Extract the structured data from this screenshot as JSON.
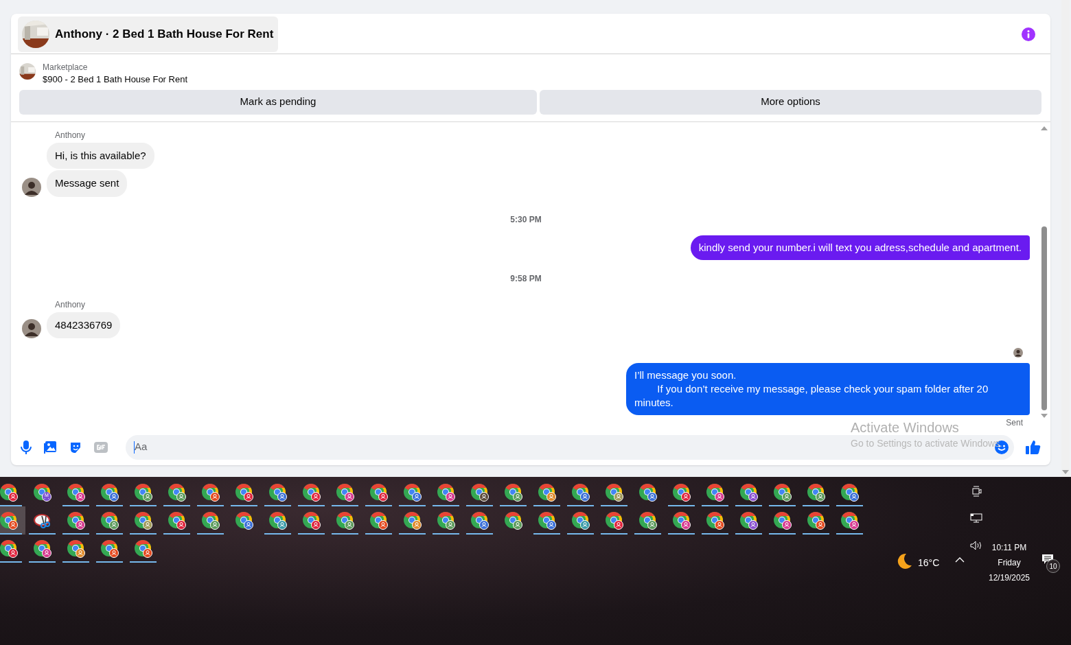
{
  "header": {
    "title": "Anthony · 2 Bed 1 Bath House For Rent"
  },
  "listing": {
    "source": "Marketplace",
    "title": "$900 - 2 Bed 1 Bath House For Rent"
  },
  "actions": [
    "Mark as pending",
    "More options"
  ],
  "messages": [
    {
      "kind": "incoming",
      "sender": "Anthony",
      "bubbles": [
        "Hi, is this available?",
        "Message sent"
      ]
    },
    {
      "kind": "time",
      "text": "5:30 PM"
    },
    {
      "kind": "outgoing",
      "text": "kindly send your number.i will text you adress,schedule and apartment.",
      "color": "#6a1bf0",
      "seen": false
    },
    {
      "kind": "time",
      "text": "9:58 PM"
    },
    {
      "kind": "incoming",
      "sender": "Anthony",
      "bubbles": [
        "4842336769"
      ]
    },
    {
      "kind": "outgoing",
      "text": "I’ll message you soon.\n        If you don’t receive my message, please check your spam folder after 20 minutes.",
      "color": "#0a5cf2",
      "seen": true,
      "status": "Sent"
    }
  ],
  "composer": {
    "placeholder": "Aa"
  },
  "os_notice": {
    "title": "Activate Windows",
    "text": "Go to Settings to activate Windows."
  },
  "taskbar": {
    "apps": [
      {
        "kind": "chrome",
        "color": "#e0233c",
        "running": true,
        "selected": false
      },
      {
        "kind": "chrome",
        "color": "#7b4fd0",
        "letter": "M",
        "running": false,
        "selected": false
      },
      {
        "kind": "chrome",
        "color": "#d8398f",
        "running": true,
        "selected": false
      },
      {
        "kind": "chrome",
        "color": "#3a6fd8",
        "running": true,
        "selected": false
      },
      {
        "kind": "chrome",
        "color": "#5b9a5b",
        "running": true,
        "selected": false
      },
      {
        "kind": "chrome",
        "color": "#5b9a5b",
        "running": true,
        "selected": false
      },
      {
        "kind": "chrome",
        "color": "#e4481d",
        "running": true,
        "selected": false
      },
      {
        "kind": "chrome",
        "color": "#e0233c",
        "running": true,
        "selected": false
      },
      {
        "kind": "chrome",
        "color": "#3a6fd8",
        "running": true,
        "selected": false
      },
      {
        "kind": "chrome",
        "color": "#e0233c",
        "running": true,
        "selected": false
      },
      {
        "kind": "chrome",
        "color": "#d8398f",
        "running": true,
        "selected": false
      },
      {
        "kind": "chrome",
        "color": "#e0233c",
        "running": true,
        "selected": false
      },
      {
        "kind": "chrome",
        "color": "#3a6fd8",
        "running": true,
        "selected": false
      },
      {
        "kind": "chrome",
        "color": "#d8398f",
        "running": true,
        "selected": false
      },
      {
        "kind": "chrome",
        "color": "#5a4a3a",
        "running": true,
        "selected": false
      },
      {
        "kind": "chrome",
        "color": "#5b9a5b",
        "running": true,
        "selected": false
      },
      {
        "kind": "chrome",
        "color": "#e08a2a",
        "running": true,
        "selected": false
      },
      {
        "kind": "chrome",
        "color": "#3a6fd8",
        "running": true,
        "selected": false
      },
      {
        "kind": "chrome",
        "color": "#a09a5a",
        "running": true,
        "selected": false
      },
      {
        "kind": "chrome",
        "color": "#3a6fd8",
        "running": false,
        "selected": false
      },
      {
        "kind": "chrome",
        "color": "#e0233c",
        "running": true,
        "selected": false
      },
      {
        "kind": "chrome",
        "color": "#d8398f",
        "running": true,
        "selected": false
      },
      {
        "kind": "chrome",
        "color": "#8a4fd0",
        "running": true,
        "selected": false
      },
      {
        "kind": "chrome",
        "color": "#5b9a5b",
        "running": true,
        "selected": false
      },
      {
        "kind": "chrome",
        "color": "#5b9a5b",
        "running": true,
        "selected": false
      },
      {
        "kind": "chrome",
        "color": "#3a6fd8",
        "running": true,
        "selected": false
      },
      {
        "kind": "chrome",
        "color": "#e4481d",
        "running": true,
        "selected": true
      },
      {
        "kind": "snip",
        "running": true,
        "selected": false
      },
      {
        "kind": "chrome",
        "color": "#d8398f",
        "running": true,
        "selected": false
      },
      {
        "kind": "chrome",
        "color": "#5b9a5b",
        "running": true,
        "selected": false
      },
      {
        "kind": "chrome",
        "color": "#a09a5a",
        "running": true,
        "selected": false
      },
      {
        "kind": "chrome",
        "color": "#e0233c",
        "running": true,
        "selected": false
      },
      {
        "kind": "chrome",
        "color": "#5b9a5b",
        "running": true,
        "selected": false
      },
      {
        "kind": "chrome",
        "color": "#3a6fd8",
        "running": false,
        "selected": false
      },
      {
        "kind": "chrome",
        "color": "#3a9aa8",
        "running": true,
        "selected": false
      },
      {
        "kind": "chrome",
        "color": "#e0233c",
        "running": true,
        "selected": false
      },
      {
        "kind": "chrome",
        "color": "#5b9a5b",
        "running": true,
        "selected": false
      },
      {
        "kind": "chrome",
        "color": "#e4481d",
        "running": true,
        "selected": false
      },
      {
        "kind": "chrome",
        "color": "#e08a2a",
        "running": true,
        "selected": false
      },
      {
        "kind": "chrome",
        "color": "#5b9a5b",
        "running": true,
        "selected": false
      },
      {
        "kind": "chrome",
        "color": "#3a6fd8",
        "running": true,
        "selected": false
      },
      {
        "kind": "chrome",
        "color": "#5b9a5b",
        "running": false,
        "selected": false
      },
      {
        "kind": "chrome",
        "color": "#3a6fd8",
        "running": true,
        "selected": false
      },
      {
        "kind": "chrome",
        "color": "#3a9aa8",
        "running": true,
        "selected": false
      },
      {
        "kind": "chrome",
        "color": "#e0233c",
        "running": true,
        "selected": false
      },
      {
        "kind": "chrome",
        "color": "#5b9a5b",
        "running": true,
        "selected": false
      },
      {
        "kind": "chrome",
        "color": "#d8398f",
        "running": true,
        "selected": false
      },
      {
        "kind": "chrome",
        "color": "#e4481d",
        "running": true,
        "selected": false
      },
      {
        "kind": "chrome",
        "color": "#8a4fd0",
        "running": true,
        "selected": false
      },
      {
        "kind": "chrome",
        "color": "#d8398f",
        "running": true,
        "selected": false
      },
      {
        "kind": "chrome",
        "color": "#e4481d",
        "running": true,
        "selected": false
      },
      {
        "kind": "chrome",
        "color": "#d8398f",
        "running": true,
        "selected": false
      },
      {
        "kind": "chrome",
        "color": "#e0233c",
        "running": true,
        "selected": false
      },
      {
        "kind": "chrome",
        "color": "#d8398f",
        "running": true,
        "selected": false
      },
      {
        "kind": "chrome",
        "color": "#e08a2a",
        "running": true,
        "selected": false
      },
      {
        "kind": "chrome",
        "color": "#e4481d",
        "running": true,
        "selected": false
      },
      {
        "kind": "chrome",
        "color": "#e4481d",
        "running": true,
        "selected": false
      }
    ],
    "weather": "16°C",
    "time": "10:11 PM",
    "day": "Friday",
    "date": "12/19/2025",
    "notifications": "10"
  }
}
